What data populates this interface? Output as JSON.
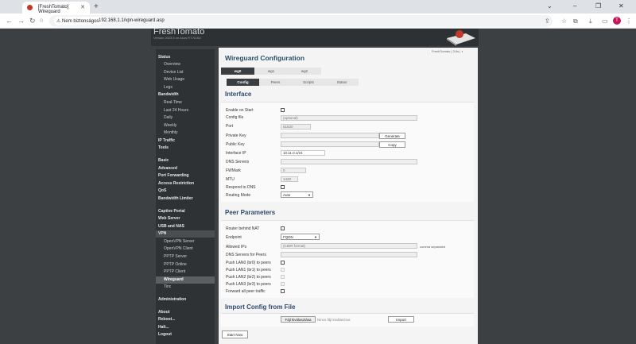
{
  "browser": {
    "tab_title": "[FreshTomato] Wireguard",
    "security_label": "Nem biztonságos",
    "url": "192.168.1.1/vpn-wireguard.asp",
    "avatar_letter": "T"
  },
  "header": {
    "brand": "FreshTomato",
    "version": "Version 2023.5 on Asus RT-N18U",
    "status_text": "FreshTomato | 3.6s | ◐"
  },
  "sidebar": {
    "status": "Status",
    "status_items": [
      "Overview",
      "Device List",
      "Web Usage",
      "Logs"
    ],
    "bandwidth": "Bandwidth",
    "bandwidth_items": [
      "Real-Time",
      "Last 24 Hours",
      "Daily",
      "Weekly",
      "Monthly"
    ],
    "ip_traffic": "IP Traffic",
    "tools": "Tools",
    "basic": "Basic",
    "advanced": "Advanced",
    "port_forwarding": "Port Forwarding",
    "access_restriction": "Access Restriction",
    "qos": "QoS",
    "bandwidth_limiter": "Bandwidth Limiter",
    "captive_portal": "Captive Portal",
    "web_server": "Web Server",
    "usb_nas": "USB and NAS",
    "vpn": "VPN",
    "vpn_items": [
      "OpenVPN Server",
      "OpenVPN Client",
      "PPTP Server",
      "PPTP Online",
      "PPTP Client",
      "Wireguard",
      "Tinc"
    ],
    "administration": "Administration",
    "about": "About",
    "reboot": "Reboot...",
    "halt": "Halt...",
    "logout": "Logout"
  },
  "main": {
    "title": "Wireguard Configuration",
    "wg_tabs": [
      "wg0",
      "wg1",
      "wg2"
    ],
    "sub_tabs": [
      "Config",
      "Peers",
      "Scripts",
      "Status"
    ],
    "interface_title": "Interface",
    "interface": {
      "enable_on_start": "Enable on Start",
      "config_file": "Config file",
      "config_file_placeholder": "(optional)",
      "port": "Port",
      "port_value": "51820",
      "private_key": "Private Key",
      "generate": "Generate",
      "public_key": "Public Key",
      "copy": "Copy",
      "interface_ip": "Interface IP",
      "interface_ip_value": "10.11.0.1/24",
      "dns_servers": "DNS Servers",
      "fwmark": "FWMark",
      "fwmark_value": "0",
      "mtu": "MTU",
      "mtu_value": "1420",
      "respond_dns": "Respond to DNS",
      "routing_mode": "Routing Mode",
      "routing_mode_value": "Auto"
    },
    "peer_title": "Peer Parameters",
    "peer": {
      "router_nat": "Router behind NAT",
      "endpoint": "Endpoint",
      "endpoint_value": "FQDN",
      "allowed_ips": "Allowed IPs",
      "allowed_ips_placeholder": "(CIDR format)",
      "comma_note": "comma separated",
      "dns_peers": "DNS Servers for Peers",
      "lan0": "Push LAN0 (br0) to peers",
      "lan1": "Push LAN1 (br1) to peers",
      "lan2": "Push LAN2 (br2) to peers",
      "lan3": "Push LAN3 (br3) to peers",
      "forward_all": "Forward all peer traffic"
    },
    "import_title": "Import Config from File",
    "import": {
      "choose_file": "Fájl kiválasztása",
      "no_file": "Nincs fájl kiválasztva",
      "import_btn": "Import"
    },
    "start_now": "Start Now"
  },
  "colors": {
    "accent": "#2e4a6a",
    "sidebar": "#2e3234",
    "selected": "#5b5f62"
  }
}
